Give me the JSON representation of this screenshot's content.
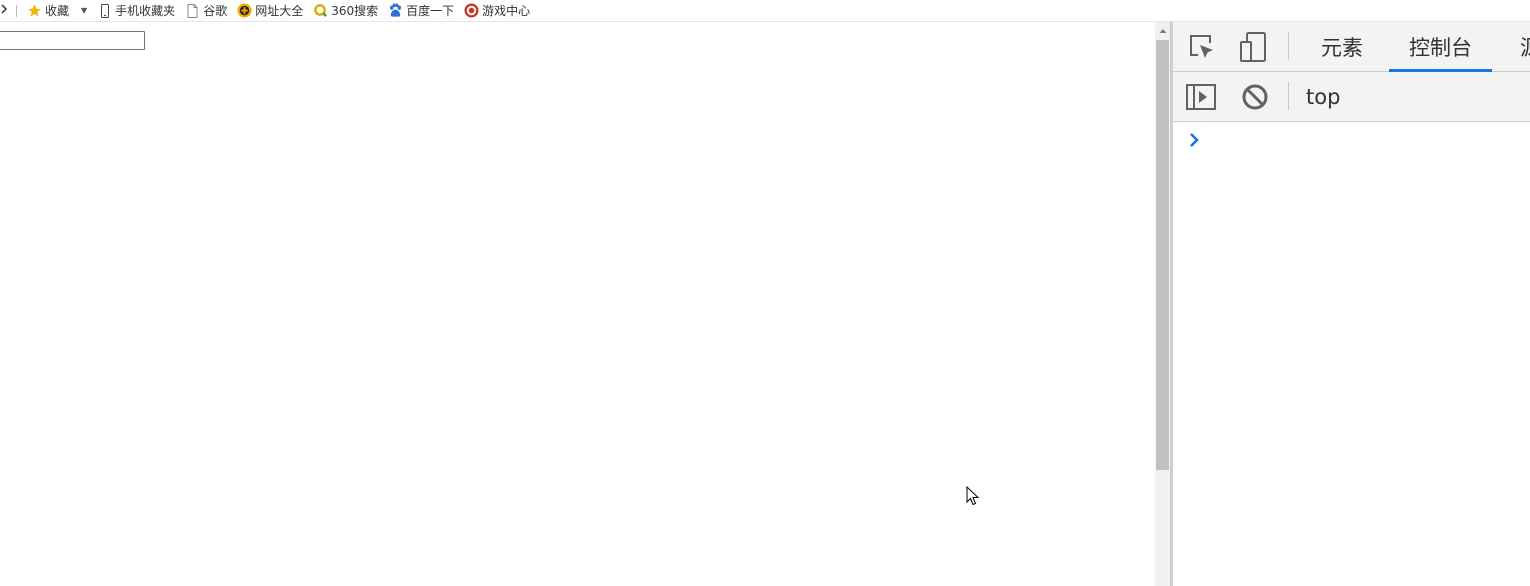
{
  "bookmarks": {
    "items": [
      {
        "label": "收藏",
        "icon": "star-icon"
      },
      {
        "label": "手机收藏夹",
        "icon": "phone-icon"
      },
      {
        "label": "谷歌",
        "icon": "page-icon"
      },
      {
        "label": "网址大全",
        "icon": "plus-circle-icon"
      },
      {
        "label": "360搜索",
        "icon": "search-ring-icon"
      },
      {
        "label": "百度一下",
        "icon": "paw-icon"
      },
      {
        "label": "游戏中心",
        "icon": "game-icon"
      }
    ]
  },
  "page": {
    "input_value": ""
  },
  "devtools": {
    "tabs": [
      {
        "label": "元素",
        "active": false
      },
      {
        "label": "控制台",
        "active": true
      },
      {
        "label": "源",
        "active": false
      }
    ],
    "context": "top",
    "accent_color": "#1a73e8",
    "prompt_color": "#1a73e8"
  }
}
